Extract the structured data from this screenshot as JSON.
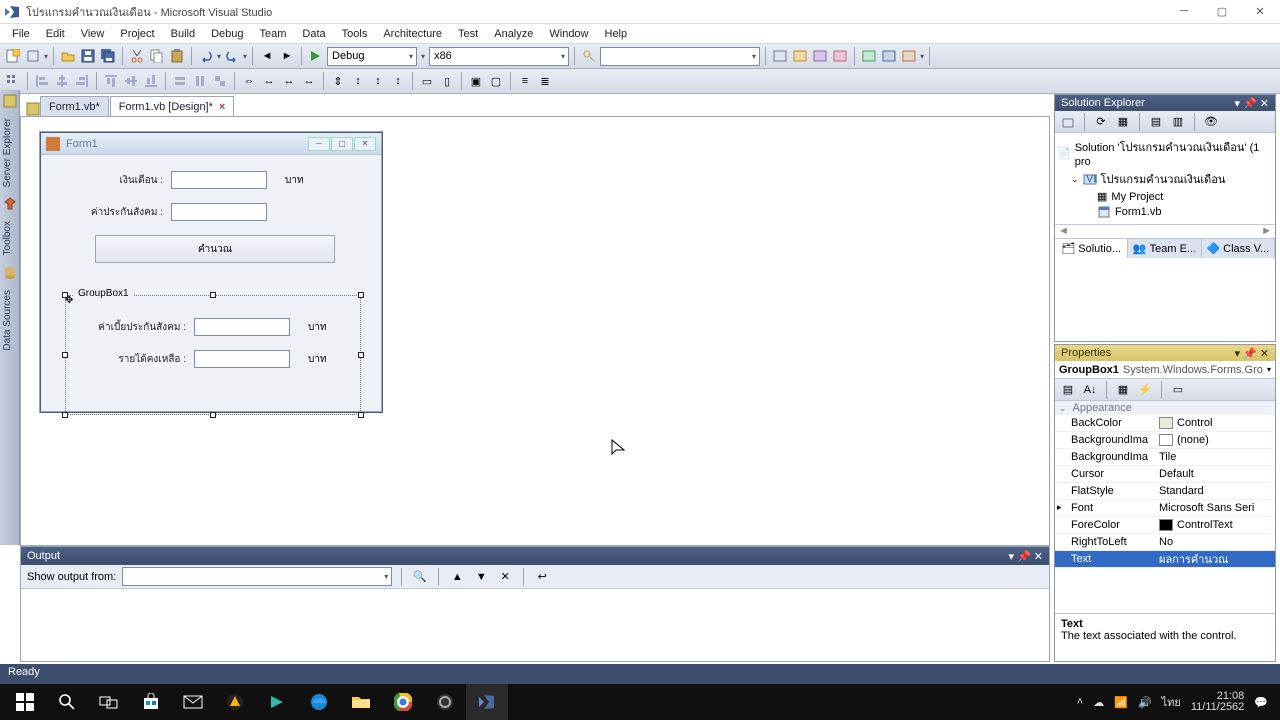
{
  "window": {
    "title": "โปรแกรมคำนวณเงินเดือน - Microsoft Visual Studio"
  },
  "menu": [
    "File",
    "Edit",
    "View",
    "Project",
    "Build",
    "Debug",
    "Team",
    "Data",
    "Tools",
    "Architecture",
    "Test",
    "Analyze",
    "Window",
    "Help"
  ],
  "toolbar": {
    "config": "Debug",
    "platform": "x86",
    "search": ""
  },
  "tabs": [
    {
      "label": "Form1.vb*",
      "active": false,
      "closable": false
    },
    {
      "label": "Form1.vb [Design]*",
      "active": true,
      "closable": true
    }
  ],
  "leftTabs": [
    "Server Explorer",
    "Toolbox",
    "Data Sources"
  ],
  "form": {
    "title": "Form1",
    "rows": [
      {
        "label": "เงินเดือน :",
        "unit": "บาท"
      },
      {
        "label": "ค่าประกันสังคม :",
        "unit": ""
      }
    ],
    "button": "คำนวณ",
    "groupbox": {
      "label": "GroupBox1",
      "rows": [
        {
          "label": "ค่าเบี้ยประกันสังคม :",
          "unit": "บาท"
        },
        {
          "label": "รายได้คงเหลือ :",
          "unit": "บาท"
        }
      ]
    }
  },
  "output": {
    "title": "Output",
    "showFrom": "Show output from:",
    "value": ""
  },
  "solutionExplorer": {
    "title": "Solution Explorer",
    "solution": "Solution 'โปรแกรมคำนวณเงินเดือน' (1 pro",
    "project": "โปรแกรมคำนวณเงินเดือน",
    "nodes": [
      "My Project",
      "Form1.vb"
    ],
    "bottomTabs": [
      "Solutio...",
      "Team E...",
      "Class V..."
    ]
  },
  "properties": {
    "title": "Properties",
    "object": "GroupBox1",
    "type": "System.Windows.Forms.Gro",
    "category": "Appearance",
    "rows": [
      {
        "name": "BackColor",
        "value": "Control",
        "swatch": "#ece9d8"
      },
      {
        "name": "BackgroundIma",
        "value": "(none)",
        "swatch": "#ffffff"
      },
      {
        "name": "BackgroundIma",
        "value": "Tile"
      },
      {
        "name": "Cursor",
        "value": "Default"
      },
      {
        "name": "FlatStyle",
        "value": "Standard"
      },
      {
        "name": "Font",
        "value": "Microsoft Sans Seri",
        "expandable": true
      },
      {
        "name": "ForeColor",
        "value": "ControlText",
        "swatch": "#000000"
      },
      {
        "name": "RightToLeft",
        "value": "No"
      },
      {
        "name": "Text",
        "value": "ผลการคำนวณ",
        "selected": true
      }
    ],
    "desc": {
      "name": "Text",
      "text": "The text associated with the control."
    }
  },
  "status": "Ready",
  "taskbar": {
    "time": "21:08",
    "date": "11/11/2562",
    "lang": "ไทย"
  }
}
